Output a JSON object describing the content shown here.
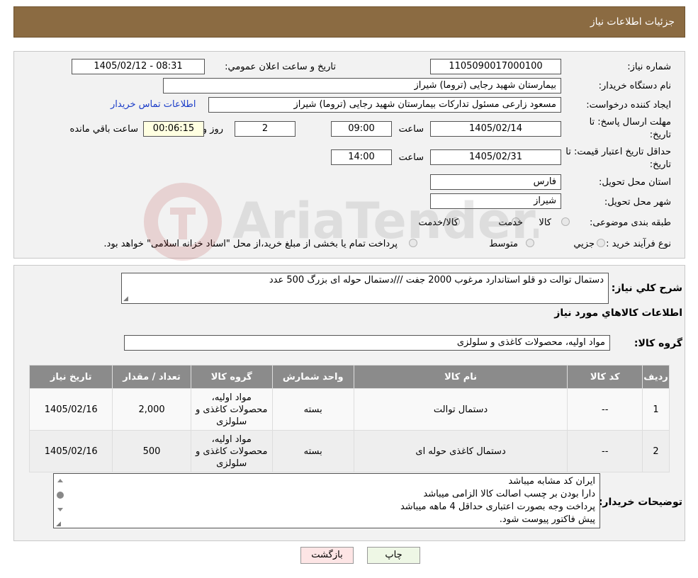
{
  "header": {
    "title": "جزئیات اطلاعات نیاز"
  },
  "info": {
    "need_number_label": "شماره نیاز:",
    "need_number": "1105090017000100",
    "announce_label": "تاریخ و ساعت اعلان عمومي:",
    "announce_value": "1405/02/12 - 08:31",
    "buyer_label": "نام دستگاه خريدار:",
    "buyer_value": "بیمارستان شهید رجایی (تروما) شیراز",
    "creator_label": "ايجاد کننده درخواست:",
    "creator_value": "مسعود زارعی مسئول تدارکات بیمارستان شهید رجایی (تروما) شیراز",
    "contact_link": "اطلاعات تماس خريدار",
    "deadline_label_1": "مهلت ارسال پاسخ: تا",
    "deadline_label_2": "تاریخ:",
    "deadline_date": "1405/02/14",
    "deadline_time_label": "ساعت",
    "deadline_time": "09:00",
    "days_value": "2",
    "days_label": "روز و",
    "remaining_time": "00:06:15",
    "remaining_label": "ساعت باقي مانده",
    "validity_label_1": "حداقل تاريخ اعتبار قيمت: تا",
    "validity_label_2": "تاریخ:",
    "validity_date": "1405/02/31",
    "validity_time_label": "ساعت",
    "validity_time": "14:00",
    "province_label": "استان محل تحويل:",
    "province_value": "فارس",
    "city_label": "شهر محل تحويل:",
    "city_value": "شیراز",
    "category_label": "طبقه بندی موضوعی:",
    "category_options": [
      "کالا",
      "خدمت",
      "کالا/خدمت"
    ],
    "process_label": "نوع فرآيند خريد :",
    "process_options": [
      "جزيي",
      "متوسط"
    ],
    "process_note": "پرداخت تمام يا بخشی از مبلغ خريد،از محل \"اسناد خزانه اسلامی\" خواهد بود."
  },
  "detail": {
    "summary_label": "شرح کلي نياز:",
    "summary_value": "دستمال توالت دو قلو  استاندارد مرغوب 2000 جفت  ///دستمال حوله ای بزرگ  500 عدد",
    "goods_title": "اطلاعات کالاهاي مورد نياز",
    "group_label": "گروه کالا:",
    "group_value": "مواد اولیه، محصولات کاغذی و سلولزی",
    "columns": [
      "رديف",
      "کد کالا",
      "نام کالا",
      "واحد شمارش",
      "گروه کالا",
      "تعداد / مقدار",
      "تاريخ نياز"
    ],
    "rows": [
      {
        "idx": "1",
        "code": "--",
        "name": "دستمال توالت",
        "unit": "بسته",
        "group": "مواد اولیه، محصولات کاغذی و سلولزی",
        "qty": "2,000",
        "date": "1405/02/16"
      },
      {
        "idx": "2",
        "code": "--",
        "name": "دستمال کاغذی حوله ای",
        "unit": "بسته",
        "group": "مواد اولیه، محصولات کاغذی و سلولزی",
        "qty": "500",
        "date": "1405/02/16"
      }
    ],
    "notes_label": "توضيحات خريدار:",
    "notes": [
      "ایران کد مشابه میباشد",
      "دارا بودن بر چسب اصالت کالا الزامی میباشد",
      "پرداخت وجه بصورت اعتباری حداقل 4 ماهه میباشد",
      "پیش فاکتور پیوست شود."
    ]
  },
  "buttons": {
    "print": "چاپ",
    "back": "بازگشت"
  },
  "watermark": {
    "text": "AriaTender.neT"
  },
  "colors": {
    "header": "#8b6b42",
    "table_header": "#8b8b8b",
    "link": "#1a3cc8",
    "back_button": "#fde5e5",
    "print_button": "#eef7e5"
  }
}
